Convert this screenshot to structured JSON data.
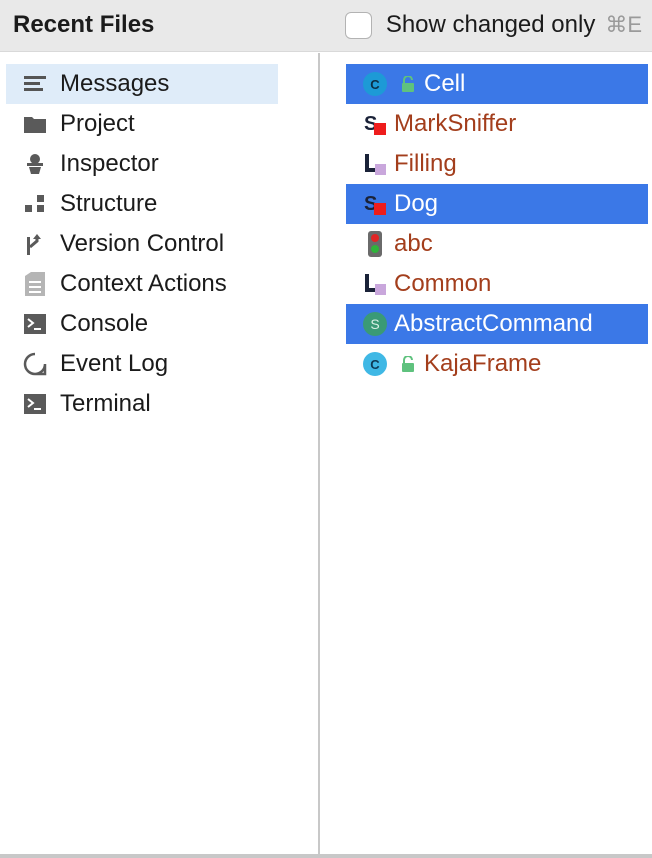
{
  "header": {
    "title": "Recent Files",
    "checkbox_label": "Show changed only",
    "shortcut": "⌘E",
    "checked": false
  },
  "tool_windows": {
    "items": [
      {
        "label": "Messages",
        "icon": "messages-icon",
        "selected": true
      },
      {
        "label": "Project",
        "icon": "folder-icon",
        "selected": false
      },
      {
        "label": "Inspector",
        "icon": "inspector-icon",
        "selected": false
      },
      {
        "label": "Structure",
        "icon": "structure-icon",
        "selected": false
      },
      {
        "label": "Version Control",
        "icon": "version-control-icon",
        "selected": false
      },
      {
        "label": "Context Actions",
        "icon": "context-actions-icon",
        "selected": false
      },
      {
        "label": "Console",
        "icon": "console-icon",
        "selected": false
      },
      {
        "label": "Event Log",
        "icon": "event-log-icon",
        "selected": false
      },
      {
        "label": "Terminal",
        "icon": "terminal-icon",
        "selected": false
      }
    ]
  },
  "files": {
    "items": [
      {
        "label": "Cell",
        "icon": "class-icon",
        "locked": true,
        "selected": true
      },
      {
        "label": "MarkSniffer",
        "icon": "sniffer-icon",
        "locked": false,
        "selected": false
      },
      {
        "label": "Filling",
        "icon": "language-icon",
        "locked": false,
        "selected": false
      },
      {
        "label": "Dog",
        "icon": "sniffer-icon",
        "locked": false,
        "selected": true
      },
      {
        "label": "abc",
        "icon": "traffic-light-icon",
        "locked": false,
        "selected": false
      },
      {
        "label": "Common",
        "icon": "language-icon",
        "locked": false,
        "selected": false
      },
      {
        "label": "AbstractCommand",
        "icon": "interface-icon",
        "locked": false,
        "selected": true
      },
      {
        "label": "KajaFrame",
        "icon": "class-icon",
        "locked": true,
        "selected": false
      }
    ]
  },
  "colors": {
    "selection_blue": "#3b78e7",
    "selection_light": "#dfecf9",
    "file_text": "#a33e1c"
  }
}
